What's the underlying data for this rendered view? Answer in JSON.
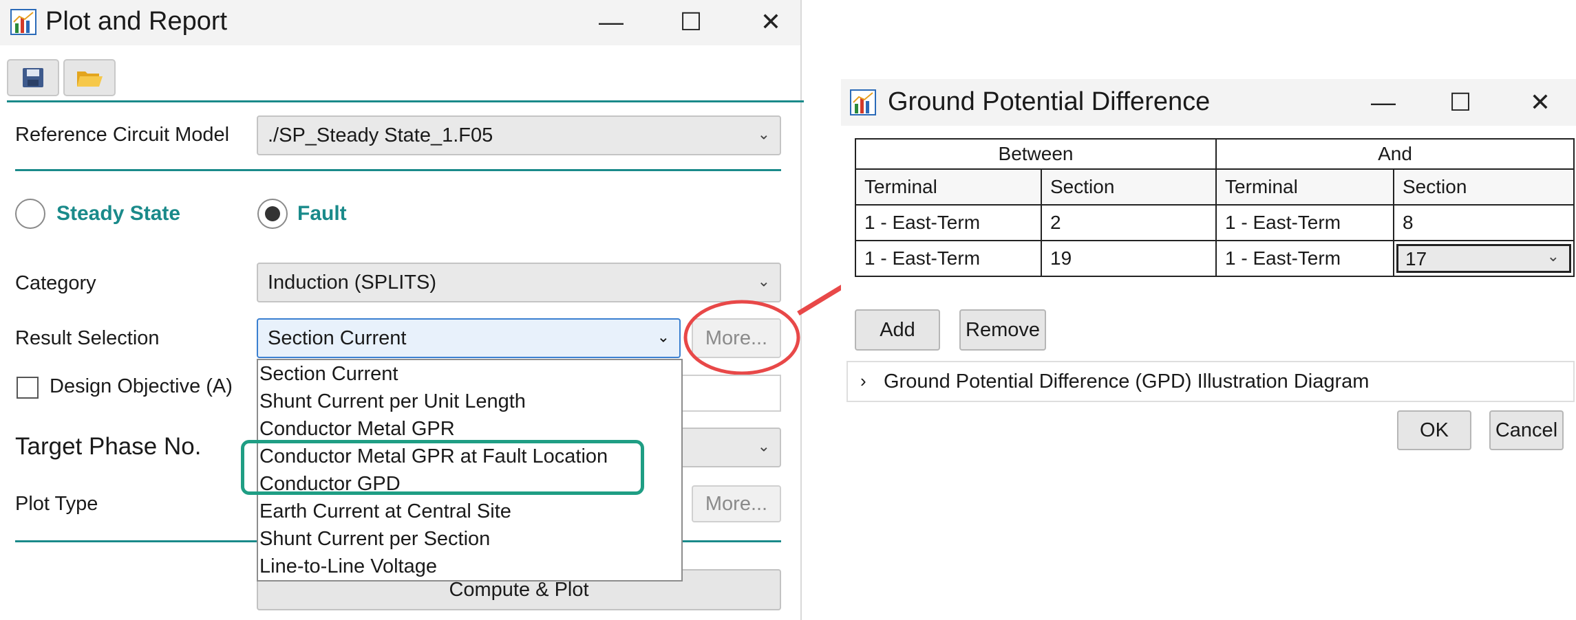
{
  "left_window": {
    "title": "Plot and Report",
    "controls": {
      "minimize": "—",
      "maximize": "☐",
      "close": "✕"
    },
    "toolbar": {
      "save_icon": "save-icon",
      "open_icon": "folder-open-icon"
    },
    "reference_circuit_label": "Reference Circuit Model",
    "reference_circuit_value": "./SP_Steady State_1.F05",
    "mode_options": [
      {
        "label": "Steady State",
        "selected": false
      },
      {
        "label": "Fault",
        "selected": true
      }
    ],
    "category_label": "Category",
    "category_value": "Induction (SPLITS)",
    "result_selection_label": "Result Selection",
    "result_selection_value": "Section Current",
    "more_label": "More...",
    "design_objective_label": "Design Objective (A)",
    "target_phase_label": "Target Phase No.",
    "plot_type_label": "Plot Type",
    "plot_type_more_label": "More...",
    "compute_label": "Compute & Plot",
    "dropdown_items": [
      "Section Current",
      "Shunt Current per Unit Length",
      "Conductor Metal GPR",
      "Conductor Metal GPR at Fault Location",
      "Conductor GPD",
      "Earth Current at Central Site",
      "Shunt Current per Section",
      "Line-to-Line Voltage"
    ],
    "accent_color": "#1a8a8a",
    "highlight_box_color": "#1f9e84",
    "callout_color": "#e84848"
  },
  "right_window": {
    "title": "Ground Potential Difference",
    "controls": {
      "minimize": "—",
      "maximize": "☐",
      "close": "✕"
    },
    "group_headers": [
      "Between",
      "And"
    ],
    "column_headers": [
      "Terminal",
      "Section",
      "Terminal",
      "Section"
    ],
    "rows": [
      [
        "1 - East-Term",
        "2",
        "1 - East-Term",
        "8"
      ],
      [
        "1 - East-Term",
        "19",
        "1 - East-Term",
        "17"
      ]
    ],
    "add_label": "Add",
    "remove_label": "Remove",
    "expander_label": "Ground Potential Difference (GPD) Illustration Diagram",
    "ok_label": "OK",
    "cancel_label": "Cancel"
  }
}
